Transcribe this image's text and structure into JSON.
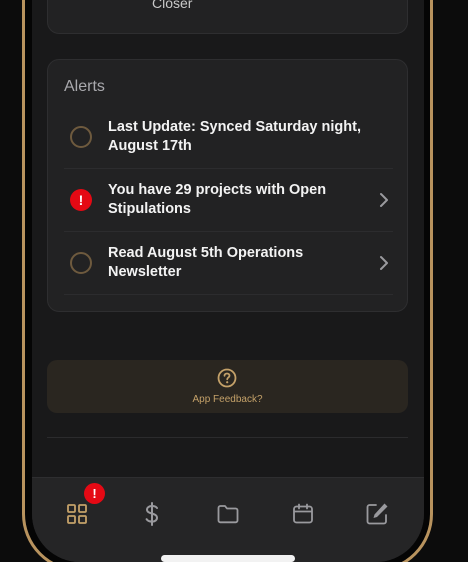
{
  "top_card": {
    "partial_text": "Closer"
  },
  "alerts": {
    "title": "Alerts",
    "items": [
      {
        "text": "Last Update: Synced Saturday night, August 17th",
        "status": "pending",
        "has_chevron": false
      },
      {
        "text": "You have 29 projects with Open Stipulations",
        "status": "warning",
        "has_chevron": true
      },
      {
        "text": "Read August 5th Operations Newsletter",
        "status": "pending",
        "has_chevron": true
      }
    ]
  },
  "feedback": {
    "icon": "question-circle-icon",
    "label": "App Feedback?"
  },
  "tabbar": {
    "tabs": [
      {
        "name": "dashboard",
        "icon": "grid-icon",
        "active": true,
        "badge": "!"
      },
      {
        "name": "pay",
        "icon": "dollar-icon",
        "active": false
      },
      {
        "name": "projects",
        "icon": "folder-icon",
        "active": false
      },
      {
        "name": "calendar",
        "icon": "calendar-icon",
        "active": false
      },
      {
        "name": "notes",
        "icon": "edit-icon",
        "active": false
      }
    ]
  },
  "colors": {
    "accent": "#c4a169",
    "frame": "#b8935e",
    "alert_red": "#e50914",
    "card_bg": "#222223",
    "screen_bg": "#19191a"
  }
}
